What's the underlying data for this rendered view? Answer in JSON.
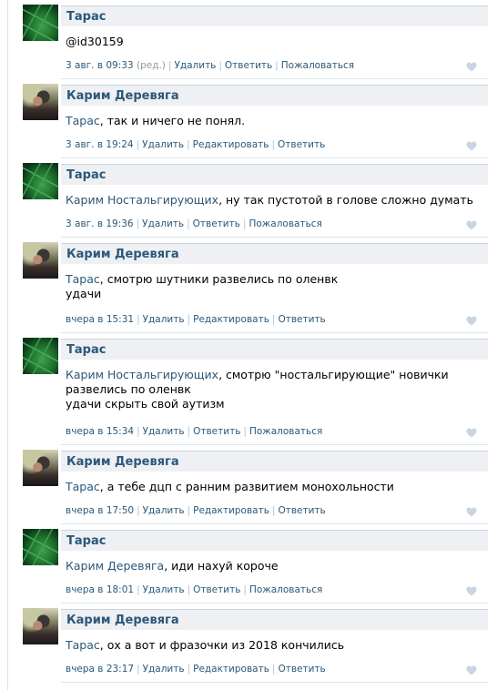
{
  "comments": [
    {
      "author": "Тарас",
      "avatar": "green-tiles",
      "text": [
        "@id30159"
      ],
      "link_name": "",
      "date": "3 авг. в 09:33",
      "edited": "(ред.)",
      "actions": [
        "Удалить",
        "Ответить",
        "Пожаловаться"
      ]
    },
    {
      "author": "Карим Деревяга",
      "avatar": "photo",
      "link_name": "Тарас",
      "text": [
        ", так и ничего не понял."
      ],
      "date": "3 авг. в 19:24",
      "edited": "",
      "actions": [
        "Удалить",
        "Редактировать",
        "Ответить"
      ]
    },
    {
      "author": "Тарас",
      "avatar": "green-tiles",
      "link_name": "Карим Ностальгирующих",
      "text": [
        ", ну так пустотой в голове сложно думать"
      ],
      "date": "3 авг. в 19:36",
      "edited": "",
      "actions": [
        "Удалить",
        "Ответить",
        "Пожаловаться"
      ]
    },
    {
      "author": "Карим Деревяга",
      "avatar": "photo",
      "link_name": "Тарас",
      "text": [
        ", смотрю шутники развелись по оленвк",
        "удачи"
      ],
      "date": "вчера в 15:31",
      "edited": "",
      "actions": [
        "Удалить",
        "Редактировать",
        "Ответить"
      ]
    },
    {
      "author": "Тарас",
      "avatar": "green-tiles",
      "link_name": "Карим Ностальгирующих",
      "text": [
        ", смотрю \"ностальгирующие\" новички",
        "развелись по оленвк",
        "удачи скрыть свой аутизм"
      ],
      "date": "вчера в 15:34",
      "edited": "",
      "actions": [
        "Удалить",
        "Ответить",
        "Пожаловаться"
      ]
    },
    {
      "author": "Карим Деревяга",
      "avatar": "photo",
      "link_name": "Тарас",
      "text": [
        ", а тебе дцп с ранним развитием монохольности"
      ],
      "date": "вчера в 17:50",
      "edited": "",
      "actions": [
        "Удалить",
        "Редактировать",
        "Ответить"
      ]
    },
    {
      "author": "Тарас",
      "avatar": "green-tiles",
      "link_name": "Карим Деревяга",
      "text": [
        ", иди нахуй короче"
      ],
      "date": "вчера в 18:01",
      "edited": "",
      "actions": [
        "Удалить",
        "Ответить",
        "Пожаловаться"
      ]
    },
    {
      "author": "Карим Деревяга",
      "avatar": "photo",
      "link_name": "Тарас",
      "text": [
        ", ох а вот и фразочки из 2018 кончились"
      ],
      "date": "вчера в 23:17",
      "edited": "",
      "actions": [
        "Удалить",
        "Редактировать",
        "Ответить"
      ]
    }
  ],
  "colors": {
    "link": "#2b587a",
    "header_bg": "#eef0f3",
    "separator": "#b4bfcc",
    "heart": "#c9d5e2",
    "muted": "#999999"
  },
  "icons": {
    "like": "heart-icon"
  }
}
